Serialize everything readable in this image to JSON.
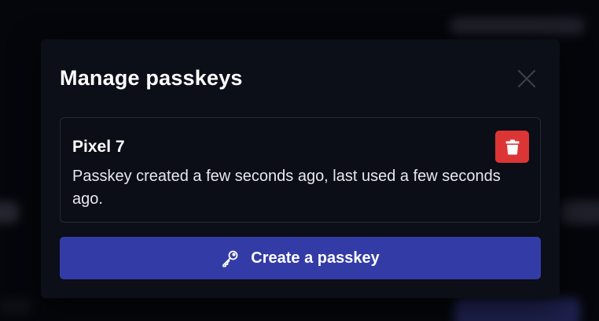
{
  "modal": {
    "title": "Manage passkeys",
    "close_icon": "close-icon"
  },
  "passkeys": [
    {
      "name": "Pixel 7",
      "description": "Passkey created a few seconds ago, last used a few seconds ago.",
      "delete_icon": "trash-icon"
    }
  ],
  "create_button": {
    "label": "Create a passkey",
    "icon": "key-icon"
  },
  "colors": {
    "modal_bg": "#0c0e18",
    "delete_red": "#dc3535",
    "primary_blue": "#333ca6",
    "border": "#262a38"
  }
}
